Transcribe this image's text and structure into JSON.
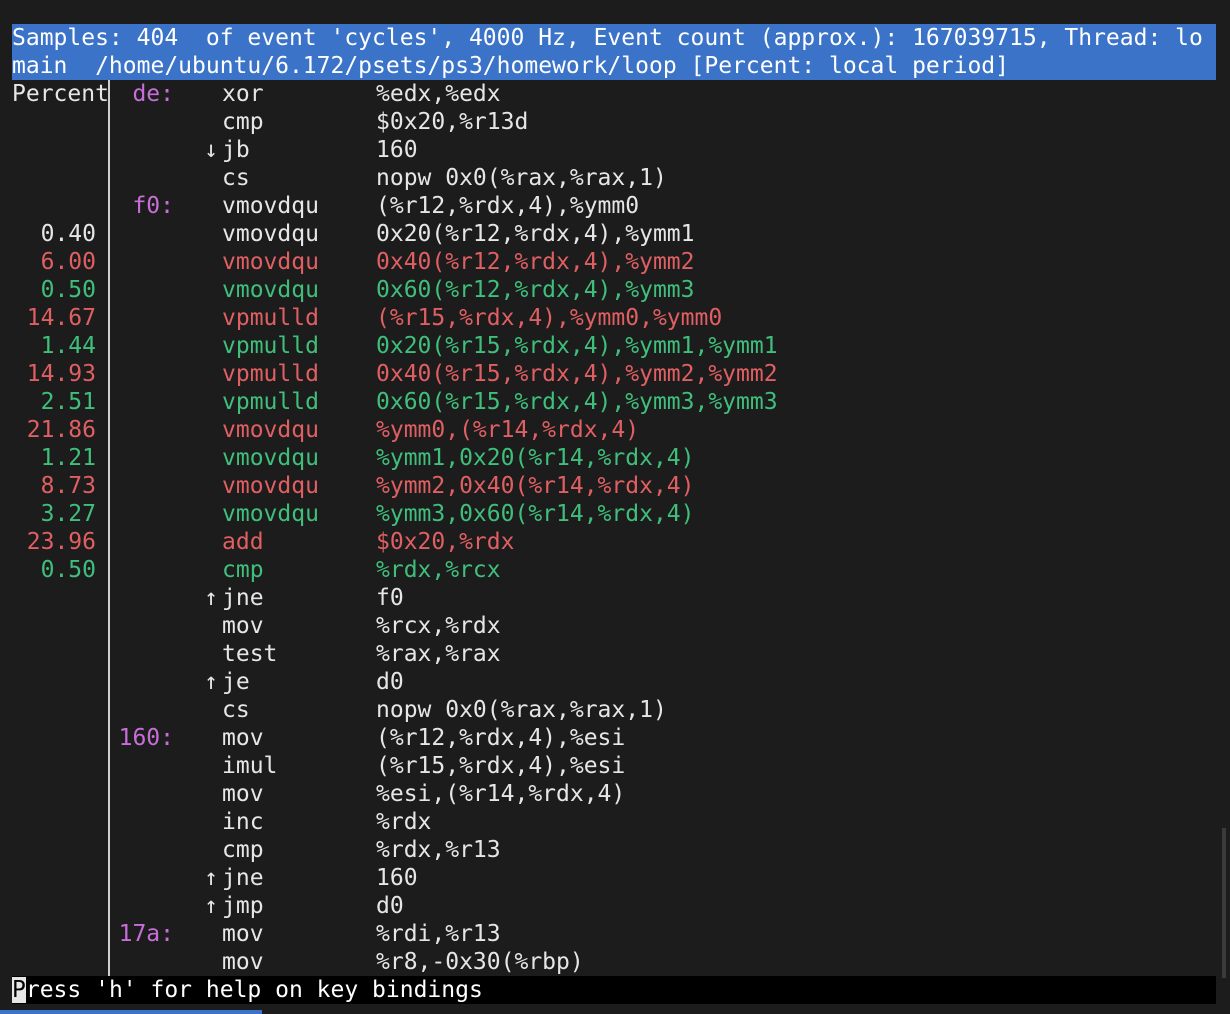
{
  "header": {
    "line1": "Samples: 404  of event 'cycles', 4000 Hz, Event count (approx.): 167039715, Thread: lo",
    "line2": "main  /home/ubuntu/6.172/psets/ps3/homework/loop [Percent: local period]"
  },
  "percent_header": "Percent",
  "colors": {
    "header_bg": "#3b73c8",
    "hot": "#e05f62",
    "warm": "#3fbf7b",
    "label": "#c86ed8",
    "text": "#e6e6e6",
    "background": "#1c1c1c"
  },
  "rows": [
    {
      "pct": "",
      "label": "de:",
      "arrow": "",
      "mnem": "xor",
      "ops": "%edx,%edx",
      "heat": "plain"
    },
    {
      "pct": "",
      "label": "",
      "arrow": "",
      "mnem": "cmp",
      "ops": "$0x20,%r13d",
      "heat": "plain"
    },
    {
      "pct": "",
      "label": "",
      "arrow": "↓",
      "mnem": "jb",
      "ops": "160",
      "heat": "plain"
    },
    {
      "pct": "",
      "label": "",
      "arrow": "",
      "mnem": "cs",
      "ops": "nopw 0x0(%rax,%rax,1)",
      "heat": "plain"
    },
    {
      "pct": "",
      "label": "f0:",
      "arrow": "",
      "mnem": "vmovdqu",
      "ops": "(%r12,%rdx,4),%ymm0",
      "heat": "plain"
    },
    {
      "pct": "0.40",
      "label": "",
      "arrow": "",
      "mnem": "vmovdqu",
      "ops": "0x20(%r12,%rdx,4),%ymm1",
      "heat": "plain"
    },
    {
      "pct": "6.00",
      "label": "",
      "arrow": "",
      "mnem": "vmovdqu",
      "ops": "0x40(%r12,%rdx,4),%ymm2",
      "heat": "hot"
    },
    {
      "pct": "0.50",
      "label": "",
      "arrow": "",
      "mnem": "vmovdqu",
      "ops": "0x60(%r12,%rdx,4),%ymm3",
      "heat": "warm"
    },
    {
      "pct": "14.67",
      "label": "",
      "arrow": "",
      "mnem": "vpmulld",
      "ops": "(%r15,%rdx,4),%ymm0,%ymm0",
      "heat": "hot"
    },
    {
      "pct": "1.44",
      "label": "",
      "arrow": "",
      "mnem": "vpmulld",
      "ops": "0x20(%r15,%rdx,4),%ymm1,%ymm1",
      "heat": "warm"
    },
    {
      "pct": "14.93",
      "label": "",
      "arrow": "",
      "mnem": "vpmulld",
      "ops": "0x40(%r15,%rdx,4),%ymm2,%ymm2",
      "heat": "hot"
    },
    {
      "pct": "2.51",
      "label": "",
      "arrow": "",
      "mnem": "vpmulld",
      "ops": "0x60(%r15,%rdx,4),%ymm3,%ymm3",
      "heat": "warm"
    },
    {
      "pct": "21.86",
      "label": "",
      "arrow": "",
      "mnem": "vmovdqu",
      "ops": "%ymm0,(%r14,%rdx,4)",
      "heat": "hot"
    },
    {
      "pct": "1.21",
      "label": "",
      "arrow": "",
      "mnem": "vmovdqu",
      "ops": "%ymm1,0x20(%r14,%rdx,4)",
      "heat": "warm"
    },
    {
      "pct": "8.73",
      "label": "",
      "arrow": "",
      "mnem": "vmovdqu",
      "ops": "%ymm2,0x40(%r14,%rdx,4)",
      "heat": "hot"
    },
    {
      "pct": "3.27",
      "label": "",
      "arrow": "",
      "mnem": "vmovdqu",
      "ops": "%ymm3,0x60(%r14,%rdx,4)",
      "heat": "warm"
    },
    {
      "pct": "23.96",
      "label": "",
      "arrow": "",
      "mnem": "add",
      "ops": "$0x20,%rdx",
      "heat": "hot"
    },
    {
      "pct": "0.50",
      "label": "",
      "arrow": "",
      "mnem": "cmp",
      "ops": "%rdx,%rcx",
      "heat": "warm"
    },
    {
      "pct": "",
      "label": "",
      "arrow": "↑",
      "mnem": "jne",
      "ops": "f0",
      "heat": "plain"
    },
    {
      "pct": "",
      "label": "",
      "arrow": "",
      "mnem": "mov",
      "ops": "%rcx,%rdx",
      "heat": "plain"
    },
    {
      "pct": "",
      "label": "",
      "arrow": "",
      "mnem": "test",
      "ops": "%rax,%rax",
      "heat": "plain"
    },
    {
      "pct": "",
      "label": "",
      "arrow": "↑",
      "mnem": "je",
      "ops": "d0",
      "heat": "plain"
    },
    {
      "pct": "",
      "label": "",
      "arrow": "",
      "mnem": "cs",
      "ops": "nopw 0x0(%rax,%rax,1)",
      "heat": "plain"
    },
    {
      "pct": "",
      "label": "160:",
      "arrow": "",
      "mnem": "mov",
      "ops": "(%r12,%rdx,4),%esi",
      "heat": "plain"
    },
    {
      "pct": "",
      "label": "",
      "arrow": "",
      "mnem": "imul",
      "ops": "(%r15,%rdx,4),%esi",
      "heat": "plain"
    },
    {
      "pct": "",
      "label": "",
      "arrow": "",
      "mnem": "mov",
      "ops": "%esi,(%r14,%rdx,4)",
      "heat": "plain"
    },
    {
      "pct": "",
      "label": "",
      "arrow": "",
      "mnem": "inc",
      "ops": "%rdx",
      "heat": "plain"
    },
    {
      "pct": "",
      "label": "",
      "arrow": "",
      "mnem": "cmp",
      "ops": "%rdx,%r13",
      "heat": "plain"
    },
    {
      "pct": "",
      "label": "",
      "arrow": "↑",
      "mnem": "jne",
      "ops": "160",
      "heat": "plain"
    },
    {
      "pct": "",
      "label": "",
      "arrow": "↑",
      "mnem": "jmp",
      "ops": "d0",
      "heat": "plain"
    },
    {
      "pct": "",
      "label": "17a:",
      "arrow": "",
      "mnem": "mov",
      "ops": "%rdi,%r13",
      "heat": "plain"
    },
    {
      "pct": "",
      "label": "",
      "arrow": "",
      "mnem": "mov",
      "ops": "%r8,-0x30(%rbp)",
      "heat": "plain"
    }
  ],
  "status": {
    "cursor_char": "P",
    "rest": "ress 'h' for help on key bindings"
  }
}
